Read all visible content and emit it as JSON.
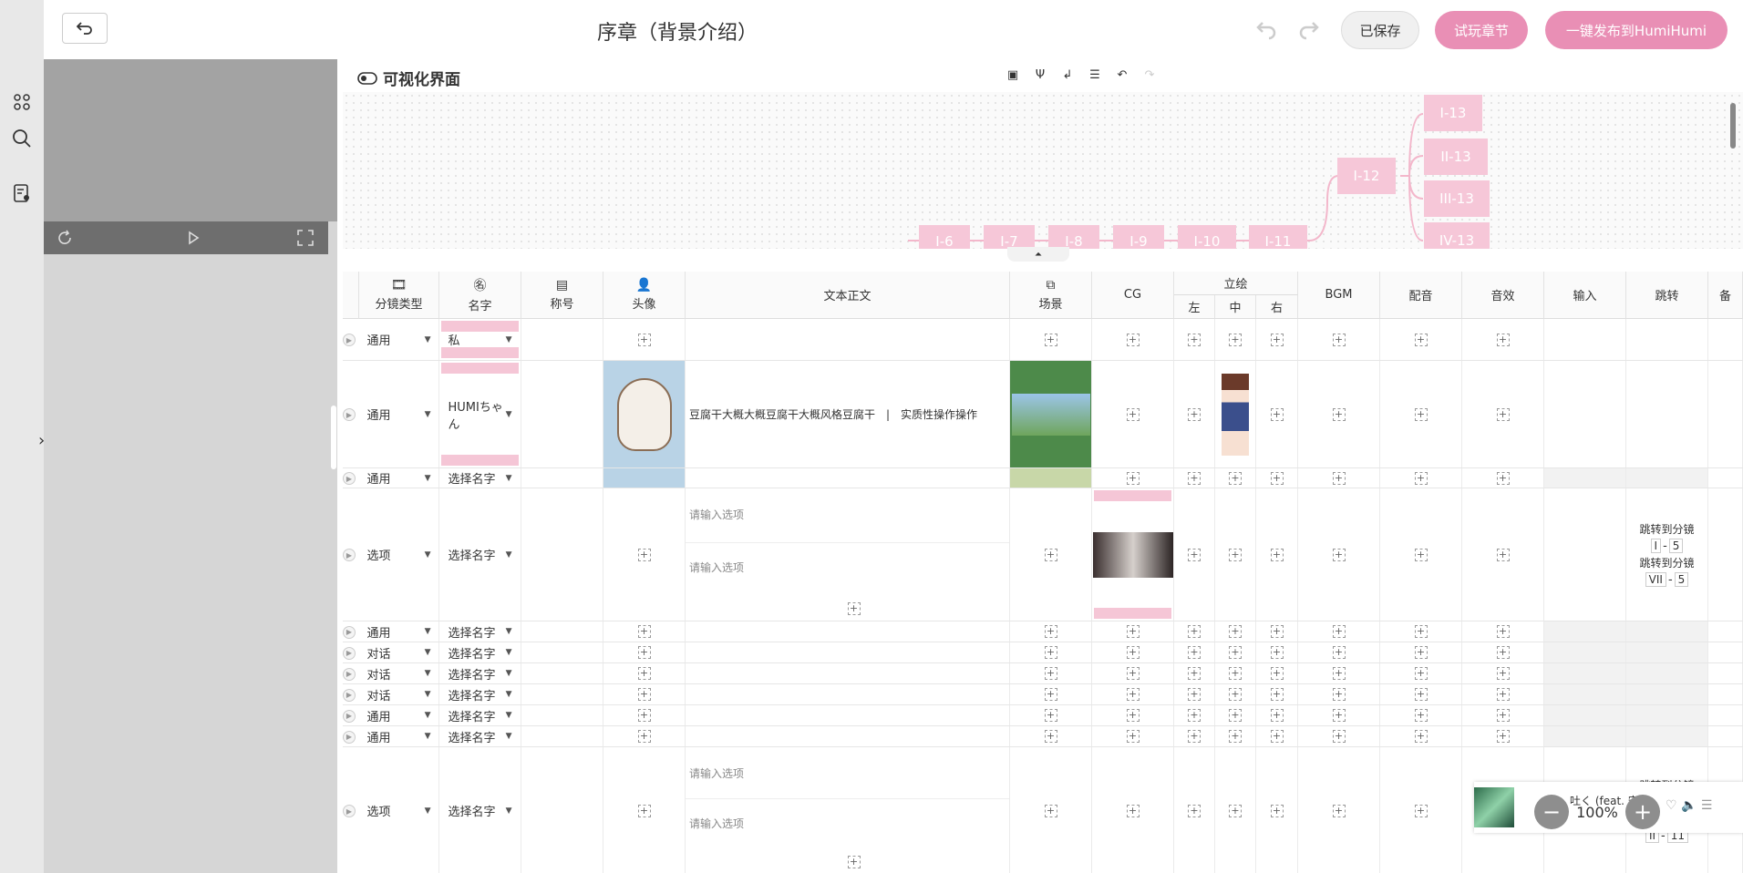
{
  "header": {
    "title": "序章（背景介绍）",
    "saved": "已保存",
    "try_play": "试玩章节",
    "publish": "一键发布到HumiHumi"
  },
  "graph": {
    "label": "可视化界面",
    "nodes": [
      "I-6",
      "I-7",
      "I-8",
      "I-9",
      "I-10",
      "I-11",
      "I-12",
      "I-13",
      "II-13",
      "III-13",
      "IV-13"
    ]
  },
  "table": {
    "headers": {
      "type": "分镜类型",
      "name": "名字",
      "title": "称号",
      "avatar": "头像",
      "text": "文本正文",
      "scene": "场景",
      "cg": "CG",
      "standing": "立绘",
      "left": "左",
      "mid": "中",
      "right": "右",
      "bgm": "BGM",
      "voice": "配音",
      "sfx": "音效",
      "input": "输入",
      "jump": "跳转",
      "more": "备"
    },
    "rows": [
      {
        "type": "通用",
        "name": "私"
      },
      {
        "type": "通用",
        "name": "HUMIちゃん",
        "text": "豆腐干大概大概豆腐干大概风格豆腐干　|　实质性操作操作"
      },
      {
        "type": "通用",
        "name": "选择名字"
      },
      {
        "type": "选项",
        "name": "选择名字",
        "opt1": "请输入选项",
        "opt2": "请输入选项",
        "jump_label": "跳转到分镜",
        "j1a": "I",
        "j1b": "5",
        "j2a": "VII",
        "j2b": "5"
      },
      {
        "type": "通用",
        "name": "选择名字"
      },
      {
        "type": "对话",
        "name": "选择名字"
      },
      {
        "type": "对话",
        "name": "选择名字"
      },
      {
        "type": "对话",
        "name": "选择名字"
      },
      {
        "type": "通用",
        "name": "选择名字"
      },
      {
        "type": "通用",
        "name": "选择名字"
      },
      {
        "type": "选项",
        "name": "选择名字",
        "opt1": "请输入选项",
        "opt2": "请输入选项",
        "jump_label": "跳转到分镜",
        "j1a": "I",
        "j1b": "11",
        "j2a": "II",
        "j2b": "11",
        "jump_label2": "跳转到分镜"
      }
    ]
  },
  "player": {
    "song": "吐く (feat. 安",
    "zoom": "100%"
  },
  "colors": {
    "pink": "#e98fb5",
    "node": "#f6c7d8"
  }
}
